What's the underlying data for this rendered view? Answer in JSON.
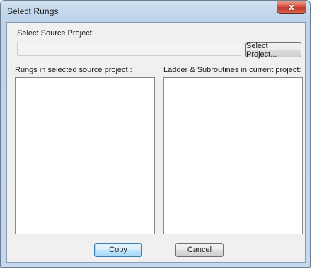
{
  "window": {
    "title": "Select Rungs",
    "close_glyph": "x"
  },
  "source": {
    "label": "Select Source Project:",
    "value": "",
    "select_button_label": "Select Project..."
  },
  "left_list": {
    "label": "Rungs in selected source project :",
    "items": []
  },
  "right_list": {
    "label": "Ladder & Subroutines in current project:",
    "items": []
  },
  "buttons": {
    "copy_label": "Copy",
    "cancel_label": "Cancel"
  },
  "colors": {
    "frame": "#c4d9ee",
    "client": "#f0f0f0",
    "close": "#c0392b",
    "default_button_border": "#3c7fb1"
  }
}
